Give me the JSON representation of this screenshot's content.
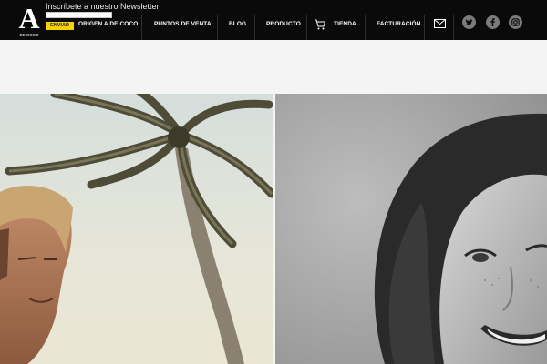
{
  "header": {
    "logo_text": "A",
    "logo_subtext": "DE COCO",
    "newsletter": {
      "label": "Inscríbete a nuestro Newsletter",
      "placeholder": "",
      "button": "ENVIAR"
    },
    "nav": [
      {
        "label": "ORIGEN A DE COCO"
      },
      {
        "label": "PUNTOS DE VENTA"
      },
      {
        "label": "BLOG"
      },
      {
        "label": "PRODUCTO"
      },
      {
        "label": "TIENDA"
      },
      {
        "label": "FACTURACIÓN"
      }
    ],
    "icons": {
      "cart": "cart-icon",
      "mail": "mail-icon",
      "social": [
        "twitter-icon",
        "facebook-icon",
        "instagram-icon"
      ]
    }
  },
  "colors": {
    "header_bg": "#0a0a0a",
    "accent": "#f4d300",
    "page_bg": "#f4f4f4",
    "social_bg": "#7b7b7b"
  },
  "images": {
    "left": "photo of a man under a palm tree against a pale sky",
    "right": "black and white photo of a smiling woman"
  }
}
